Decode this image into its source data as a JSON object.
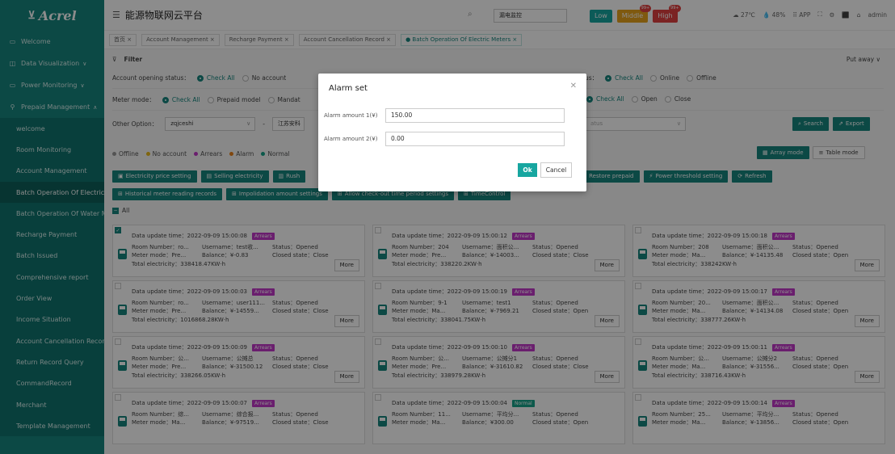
{
  "app": {
    "logo": "Acrel",
    "title": "能源物联网云平台"
  },
  "sidebar": {
    "items": [
      {
        "label": "Welcome",
        "icon": "monitor-icon",
        "chev": ""
      },
      {
        "label": "Data Visualization",
        "icon": "chart-icon",
        "chev": "∨"
      },
      {
        "label": "Power Monitoring",
        "icon": "monitor-icon",
        "chev": "∨"
      },
      {
        "label": "Prepaid Management",
        "icon": "user-icon",
        "chev": "∧"
      }
    ],
    "subitems": [
      "welcome",
      "Room Monitoring",
      "Account Management",
      "Batch Operation Of Electric",
      "Batch Operation Of Water M",
      "Recharge Payment",
      "Batch Issued",
      "Comprehensive report",
      "Order View",
      "Income Situation",
      "Account Cancellation Recor",
      "Return Record Query",
      "CommandRecord",
      "Merchant",
      "Template Management"
    ]
  },
  "header": {
    "search_value": "漏电监控",
    "badges": [
      {
        "label": "Low",
        "count": "",
        "color": "#17a6a0"
      },
      {
        "label": "Middle",
        "count": "99+",
        "color": "#e8a21c"
      },
      {
        "label": "High",
        "count": "99+",
        "color": "#e04040"
      }
    ],
    "status": [
      "☁ 27℃",
      "💧 48%",
      "⠿ APP",
      "⛶",
      "⚙",
      "⬛",
      "⌂",
      "admin"
    ]
  },
  "tabs": [
    "首页 ×",
    "Account Management ×",
    "Recharge Payment ×",
    "Account Cancellation Record ×",
    "● Batch Operation Of Electric Meters ×"
  ],
  "filter": {
    "title": "Filter",
    "putaway": "Put away ∨",
    "row1_label": "Account opening status：",
    "row1_opts": [
      "Check All",
      "No account"
    ],
    "row1b_label": "us：",
    "row1b_opts": [
      "Check All",
      "Online",
      "Offline"
    ],
    "row2_label": "Meter mode：",
    "row2_opts": [
      "Check All",
      "Prepaid model",
      "Mandat"
    ],
    "row2b_opts": [
      "Check All",
      "Open",
      "Close"
    ],
    "row3_label": "Other Option：",
    "row3_sel": "zqjceshi",
    "row3_sel2": "江苏安科",
    "row3_sel3": "atus",
    "search_btn": "Search",
    "export_btn": "Export"
  },
  "legend": [
    {
      "label": "Offline",
      "color": "#999"
    },
    {
      "label": "No account",
      "color": "#e8b91c"
    },
    {
      "label": "Arrears",
      "color": "#c238c9"
    },
    {
      "label": "Alarm",
      "color": "#e8821c"
    },
    {
      "label": "Normal",
      "color": "#17a389"
    }
  ],
  "modes": {
    "array": "Array mode",
    "table": "Table mode"
  },
  "actions1": [
    "Electricity price setting",
    "Selling electricity",
    "Rush",
    "Restore prepaid",
    "Power threshold setting",
    "Refresh"
  ],
  "actions2": [
    "Historical meter reading records",
    "Impolidation amount settings",
    "Allow check-out time period settings",
    "TimeControl"
  ],
  "all_label": "All",
  "cards": [
    {
      "time": "2022-09-09 15:00:08",
      "tag": "Arrears",
      "room": "ro...",
      "user": "test收...",
      "status": "Opened",
      "mode": "Pre...",
      "bal": "¥-0.83",
      "closed": "Close",
      "total": "338418.47KW·h",
      "checked": true
    },
    {
      "time": "2022-09-09 15:00:12",
      "tag": "Arrears",
      "room": "204",
      "user": "面积公...",
      "status": "Opened",
      "mode": "Pre...",
      "bal": "¥-14003...",
      "closed": "Close",
      "total": "338220.2KW·h",
      "checked": false
    },
    {
      "time": "2022-09-09 15:00:18",
      "tag": "Arrears",
      "room": "208",
      "user": "面积公...",
      "status": "Opened",
      "mode": "Ma...",
      "bal": "¥-14135.48",
      "closed": "Open",
      "total": "338242KW·h",
      "checked": false
    },
    {
      "time": "2022-09-09 15:00:03",
      "tag": "Arrears",
      "room": "ro...",
      "user": "user111...",
      "status": "Opened",
      "mode": "Pre...",
      "bal": "¥-14559...",
      "closed": "Close",
      "total": "1016868.28KW·h",
      "checked": false
    },
    {
      "time": "2022-09-09 15:00:19",
      "tag": "Arrears",
      "room": "9-1",
      "user": "test1",
      "status": "Opened",
      "mode": "Ma...",
      "bal": "¥-7969.21",
      "closed": "Open",
      "total": "338041.75KW·h",
      "checked": false
    },
    {
      "time": "2022-09-09 15:00:17",
      "tag": "Arrears",
      "room": "20...",
      "user": "面积公...",
      "status": "Opened",
      "mode": "Ma...",
      "bal": "¥-14134.08",
      "closed": "Open",
      "total": "338777.26KW·h",
      "checked": false
    },
    {
      "time": "2022-09-09 15:00:09",
      "tag": "Arrears",
      "room": "公...",
      "user": "公摊总",
      "status": "Opened",
      "mode": "Pre...",
      "bal": "¥-31500.12",
      "closed": "Close",
      "total": "338266.05KW·h",
      "checked": false
    },
    {
      "time": "2022-09-09 15:00:10",
      "tag": "Arrears",
      "room": "公...",
      "user": "公摊分1",
      "status": "Opened",
      "mode": "Pre...",
      "bal": "¥-31610.82",
      "closed": "Close",
      "total": "338979.28KW·h",
      "checked": false
    },
    {
      "time": "2022-09-09 15:00:11",
      "tag": "Arrears",
      "room": "公...",
      "user": "公摊分2",
      "status": "Opened",
      "mode": "Ma...",
      "bal": "¥-31556...",
      "closed": "Open",
      "total": "338716.43KW·h",
      "checked": false
    },
    {
      "time": "2022-09-09 15:00:07",
      "tag": "Arrears",
      "room": "综...",
      "user": "综合报...",
      "status": "Opened",
      "mode": "Ma...",
      "bal": "¥-97519...",
      "closed": "Close",
      "total": "",
      "checked": false
    },
    {
      "time": "2022-09-09 15:00:04",
      "tag": "Normal",
      "room": "11...",
      "user": "平均分...",
      "status": "Opened",
      "mode": "Ma...",
      "bal": "¥300.00",
      "closed": "Open",
      "total": "",
      "checked": false
    },
    {
      "time": "2022-09-09 15:00:14",
      "tag": "Arrears",
      "room": "25...",
      "user": "平均分...",
      "status": "Opened",
      "mode": "Ma...",
      "bal": "¥-13856...",
      "closed": "Open",
      "total": "",
      "checked": false
    }
  ],
  "card_labels": {
    "time": "Data update time：",
    "room": "Room Number：",
    "user": "Username：",
    "status": "Status：",
    "mode": "Meter mode：",
    "bal": "Balance：",
    "closed": "Closed state：",
    "total": "Total electricity：",
    "more": "More"
  },
  "modal": {
    "title": "Alarm set",
    "label1": "Alarm amount 1(¥)",
    "value1": "150.00",
    "label2": "Alarm amount 2(¥)",
    "value2": "0.00",
    "ok": "Ok",
    "cancel": "Cancel"
  }
}
